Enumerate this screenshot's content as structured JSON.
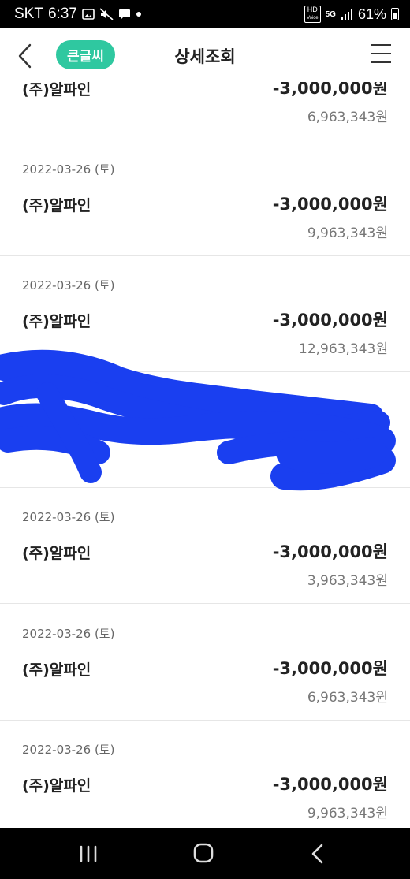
{
  "status_bar": {
    "carrier": "SKT",
    "time": "6:37",
    "network": "5G",
    "battery": "61%",
    "hd_label": "HD",
    "voice_label": "Voice"
  },
  "header": {
    "back_icon": "chevron-left-icon",
    "bigtext_label": "큰글씨",
    "title": "상세조회",
    "menu_icon": "hamburger-menu-icon",
    "accent_color": "#2fc8a0"
  },
  "transactions": [
    {
      "date": "",
      "name": "(주)알파인",
      "amount": "-3,000,000원",
      "balance": "6,963,343원"
    },
    {
      "date": "2022-03-26 (토)",
      "name": "(주)알파인",
      "amount": "-3,000,000원",
      "balance": "9,963,343원"
    },
    {
      "date": "2022-03-26 (토)",
      "name": "(주)알파인",
      "amount": "-3,000,000원",
      "balance": "12,963,343원"
    },
    {
      "date": "",
      "name": "",
      "amount": "",
      "balance": ""
    },
    {
      "date": "2022-03-26 (토)",
      "name": "(주)알파인",
      "amount": "-3,000,000원",
      "balance": "3,963,343원"
    },
    {
      "date": "2022-03-26 (토)",
      "name": "(주)알파인",
      "amount": "-3,000,000원",
      "balance": "6,963,343원"
    },
    {
      "date": "2022-03-26 (토)",
      "name": "(주)알파인",
      "amount": "-3,000,000원",
      "balance": "9,963,343원"
    }
  ],
  "redaction_color": "#1a3ff0",
  "navbar": {
    "recents_icon": "recents-icon",
    "home_icon": "home-icon",
    "back_icon": "back-icon"
  }
}
